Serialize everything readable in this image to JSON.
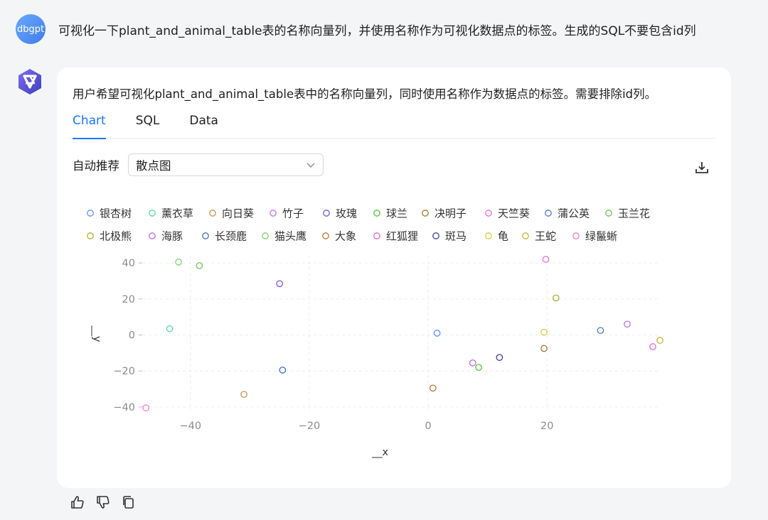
{
  "conversation": {
    "user_name": "dbgpt",
    "question": "可视化一下plant_and_animal_table表的名称向量列，并使用名称作为可视化数据点的标签。生成的SQL不要包含id列",
    "answer_summary": "用户希望可视化plant_and_animal_table表中的名称向量列，同时使用名称作为数据点的标签。需要排除id列。"
  },
  "tabs": [
    {
      "label": "Chart",
      "active": true
    },
    {
      "label": "SQL",
      "active": false
    },
    {
      "label": "Data",
      "active": false
    }
  ],
  "recommend": {
    "label": "自动推荐",
    "selected": "散点图"
  },
  "icons": {
    "download": "download-icon",
    "like": "thumbs-up-icon",
    "dislike": "thumbs-down-icon",
    "copy": "copy-icon",
    "select": "chevron-down-icon"
  },
  "chart_data": {
    "type": "scatter",
    "xlabel": "__x",
    "ylabel": "__y",
    "xlim": [
      -48,
      39
    ],
    "ylim": [
      -42,
      44
    ],
    "xticks": [
      -40,
      -20,
      0,
      20
    ],
    "yticks": [
      40,
      20,
      0,
      -20,
      -40
    ],
    "grid": true,
    "legend_position": "top",
    "series": [
      {
        "name": "银杏树",
        "color": "#5b8ff9",
        "x": 1.5,
        "y": 1.0
      },
      {
        "name": "薰衣草",
        "color": "#5ad8a6",
        "x": -43.5,
        "y": 3.5
      },
      {
        "name": "向日葵",
        "color": "#c98f4a",
        "x": -31.0,
        "y": -33.0
      },
      {
        "name": "竹子",
        "color": "#c273e8",
        "x": 33.5,
        "y": 6.0
      },
      {
        "name": "玫瑰",
        "color": "#6f5ce0",
        "x": -25.0,
        "y": 28.5
      },
      {
        "name": "球兰",
        "color": "#52c23b",
        "x": 8.5,
        "y": -18.0
      },
      {
        "name": "决明子",
        "color": "#a6752f",
        "x": 19.5,
        "y": -7.5
      },
      {
        "name": "天竺葵",
        "color": "#e86ed8",
        "x": 19.8,
        "y": 42.0
      },
      {
        "name": "蒲公英",
        "color": "#4b7bbf",
        "x": 29.0,
        "y": 2.5
      },
      {
        "name": "玉兰花",
        "color": "#6ac15a",
        "x": -38.5,
        "y": 38.5
      },
      {
        "name": "北极熊",
        "color": "#a8b02a",
        "x": 21.5,
        "y": 20.5
      },
      {
        "name": "海豚",
        "color": "#c06adf",
        "x": 7.5,
        "y": -15.5
      },
      {
        "name": "长颈鹿",
        "color": "#3c6fbf",
        "x": -24.5,
        "y": -19.5
      },
      {
        "name": "猫头鹰",
        "color": "#78d46a",
        "x": -42.0,
        "y": 40.5
      },
      {
        "name": "大象",
        "color": "#b7772e",
        "x": 0.8,
        "y": -29.5
      },
      {
        "name": "红狐狸",
        "color": "#e06cd0",
        "x": 37.8,
        "y": -6.5
      },
      {
        "name": "斑马",
        "color": "#3a3f9c",
        "x": 12.0,
        "y": -12.5
      },
      {
        "name": "龟",
        "color": "#d6cf3a",
        "x": 19.5,
        "y": 1.5
      },
      {
        "name": "王蛇",
        "color": "#cfb12c",
        "x": 39.0,
        "y": -3.0
      },
      {
        "name": "绿鬣蜥",
        "color": "#f07ad2",
        "x": -47.5,
        "y": -40.5
      }
    ]
  }
}
